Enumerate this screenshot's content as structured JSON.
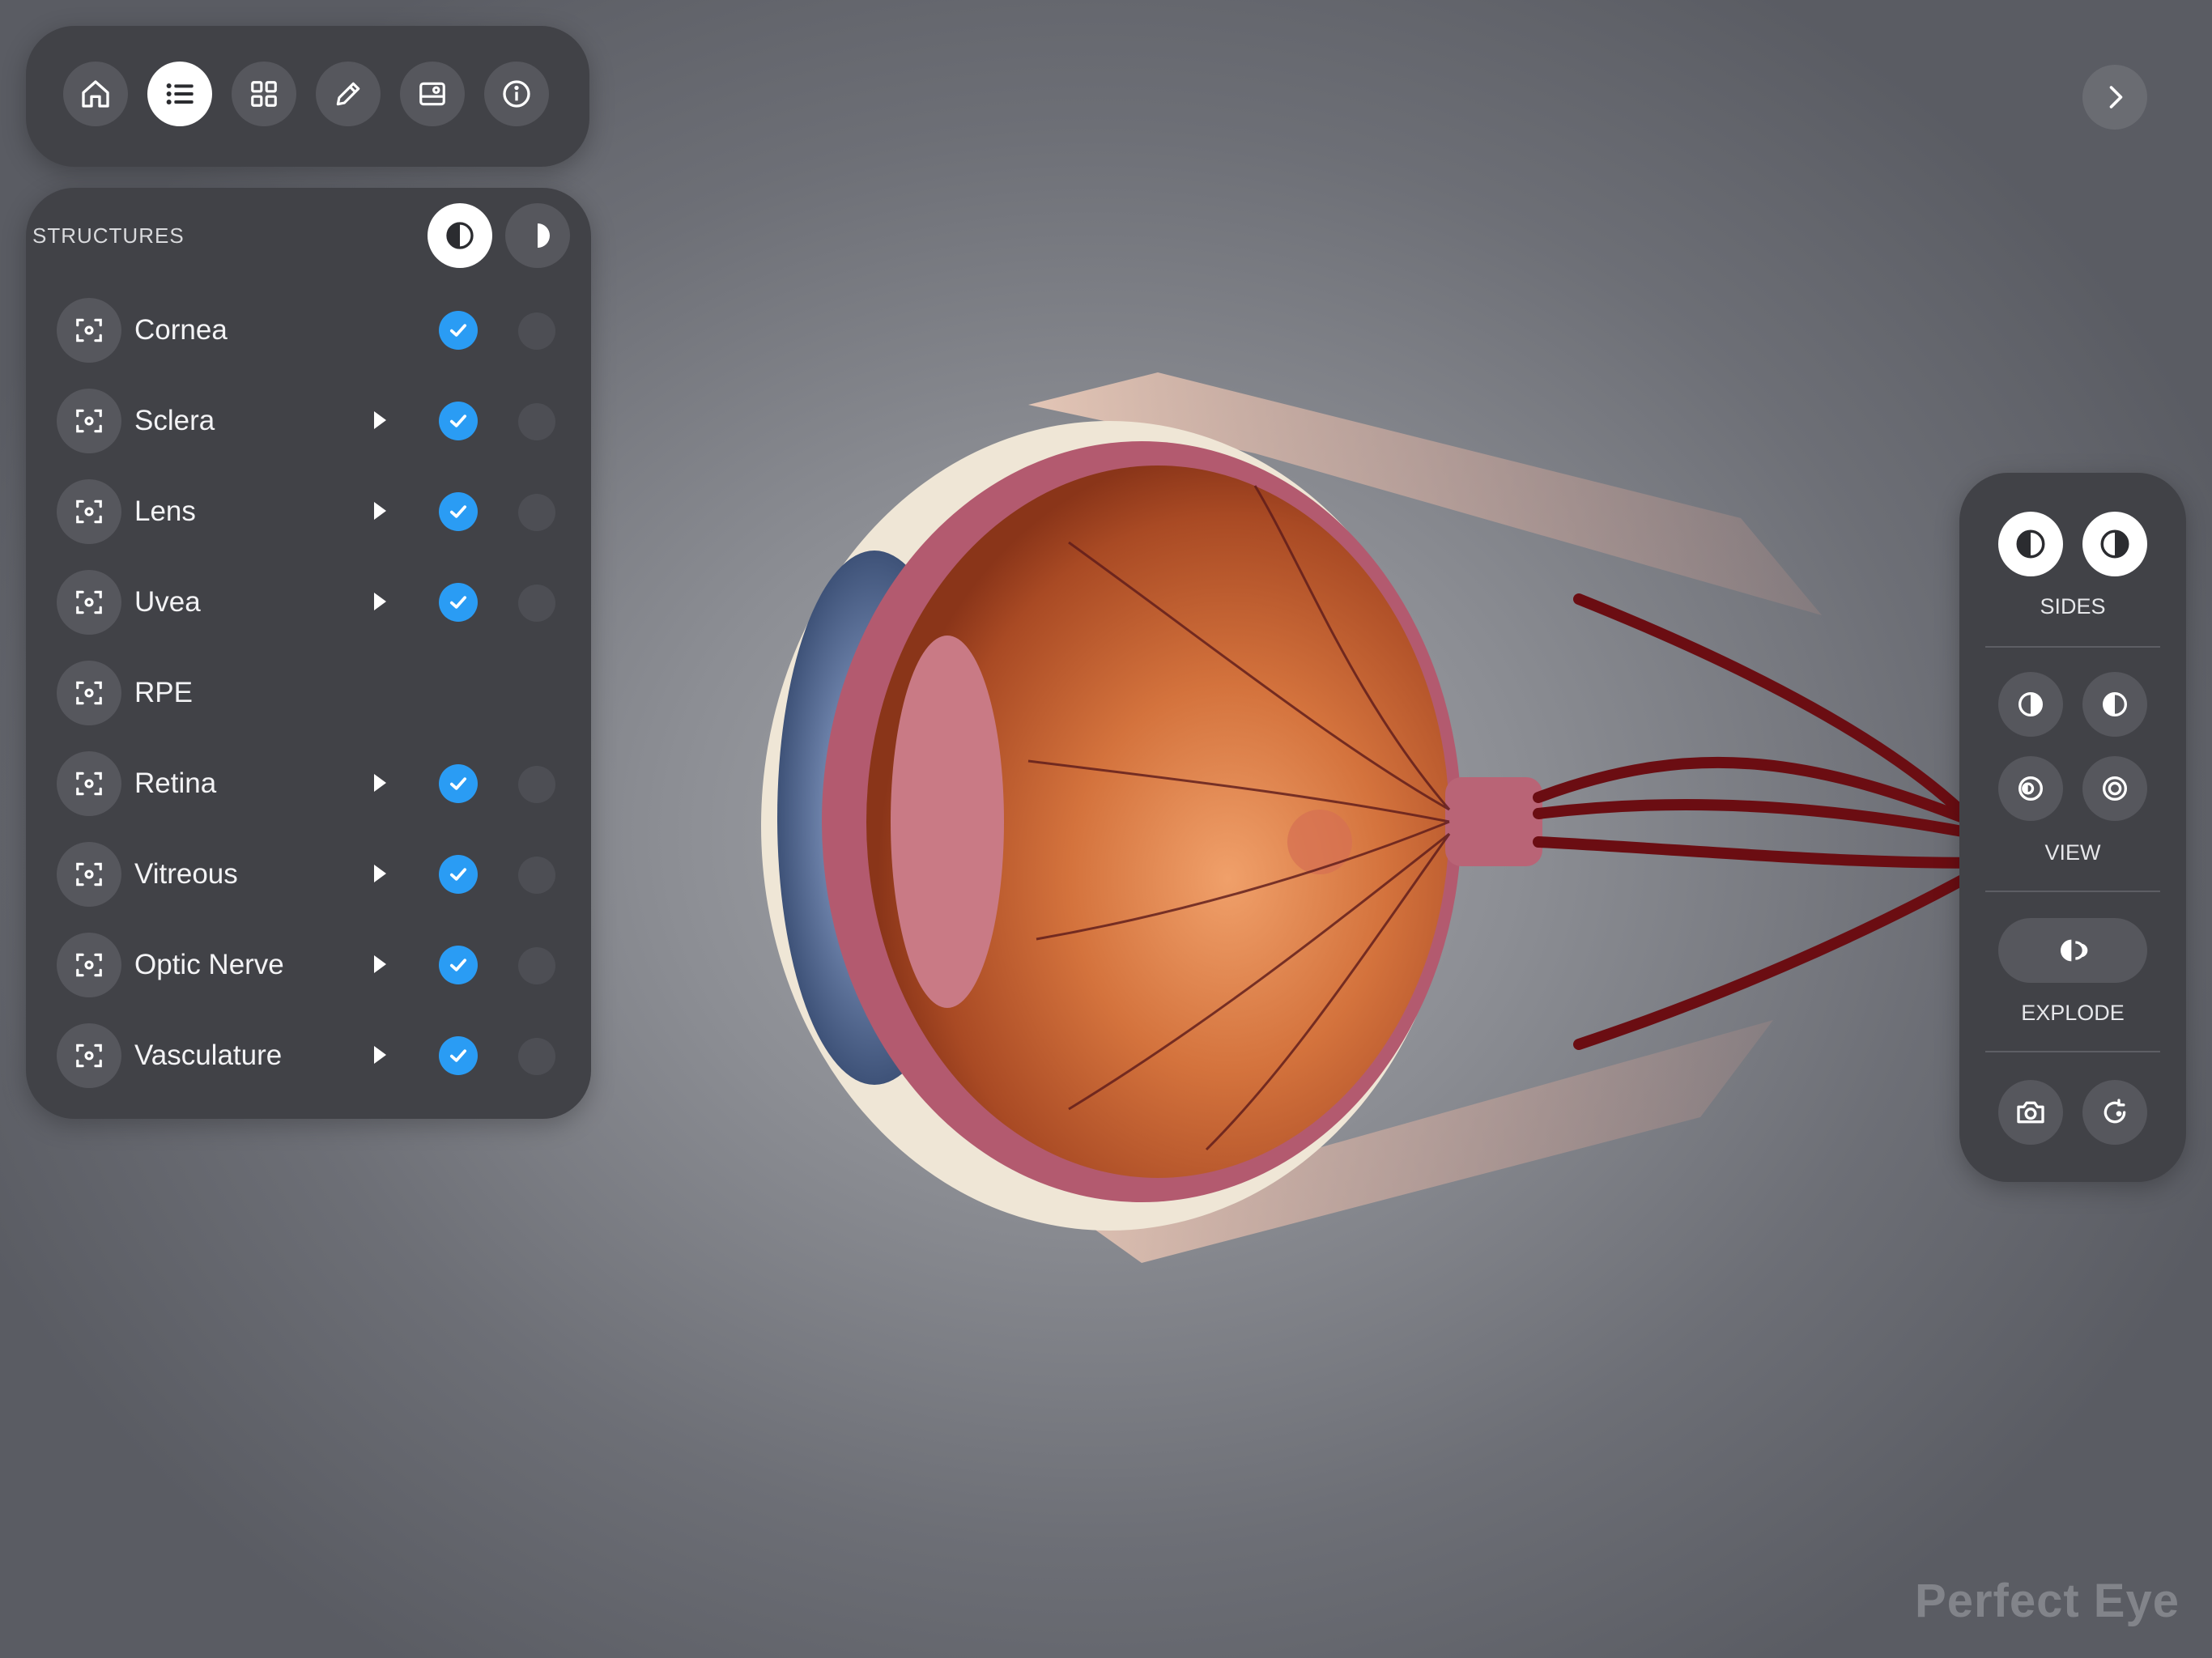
{
  "toolbar": {
    "buttons": [
      {
        "icon": "home-icon",
        "active": false
      },
      {
        "icon": "list-icon",
        "active": true
      },
      {
        "icon": "grid-icon",
        "active": false
      },
      {
        "icon": "pencil-icon",
        "active": false
      },
      {
        "icon": "image-card-icon",
        "active": false
      },
      {
        "icon": "info-icon",
        "active": false
      }
    ]
  },
  "structures": {
    "title": "STRUCTURES",
    "side_toggles": [
      "left-half-icon",
      "right-half-icon"
    ],
    "items": [
      {
        "label": "Cornea",
        "has_children": false,
        "visible": true
      },
      {
        "label": "Sclera",
        "has_children": true,
        "visible": true
      },
      {
        "label": "Lens",
        "has_children": true,
        "visible": true
      },
      {
        "label": "Uvea",
        "has_children": true,
        "visible": true
      },
      {
        "label": "RPE",
        "has_children": false,
        "visible": null
      },
      {
        "label": "Retina",
        "has_children": true,
        "visible": true
      },
      {
        "label": "Vitreous",
        "has_children": true,
        "visible": true
      },
      {
        "label": "Optic Nerve",
        "has_children": true,
        "visible": true
      },
      {
        "label": "Vasculature",
        "has_children": true,
        "visible": true
      }
    ]
  },
  "right_panel": {
    "sides_label": "SIDES",
    "view_label": "VIEW",
    "explode_label": "EXPLODE"
  },
  "brand": "Perfect Eye",
  "colors": {
    "accent_check": "#2a9cf4",
    "panel": "#414247",
    "button": "#56575d"
  }
}
